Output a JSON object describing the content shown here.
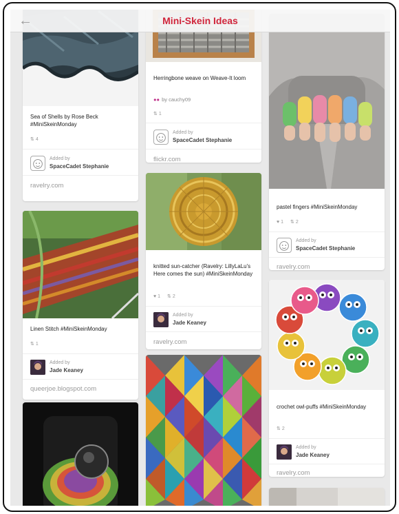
{
  "header": {
    "title": "Mini-Skein Ideas",
    "back_icon": "arrow-left-icon"
  },
  "colors": {
    "title": "#d0253b",
    "background": "#e9e9e9"
  },
  "pins": [
    {
      "description": "Sea of Shells by Rose Beck #MiniSkeinMonday",
      "repins": "4",
      "added_label": "Added by",
      "added_by": "SpaceCadet Stephanie",
      "domain": "ravelry.com"
    },
    {
      "description": "Linen Stitch #MiniSkeinMonday",
      "repins": "1",
      "added_label": "Added by",
      "added_by": "Jade Keaney",
      "domain": "queerjoe.blogspot.com"
    },
    {
      "description": "Herringbone weave on Weave-It loom",
      "by_label": "by cauchy09",
      "repins": "1",
      "added_label": "Added by",
      "added_by": "SpaceCadet Stephanie",
      "domain": "flickr.com"
    },
    {
      "description": "knitted sun-catcher  (Ravelry: LillyLaLu's Here comes the sun) #MiniSkeinMonday",
      "likes": "1",
      "repins": "2",
      "added_label": "Added by",
      "added_by": "Jade Keaney",
      "domain": "ravelry.com"
    },
    {
      "description": "pastel fingers #MiniSkeinMonday",
      "likes": "1",
      "repins": "2",
      "added_label": "Added by",
      "added_by": "SpaceCadet Stephanie",
      "domain": "ravelry.com"
    },
    {
      "description": "crochet owl-puffs #MiniSkeinMonday",
      "repins": "2",
      "added_label": "Added by",
      "added_by": "Jade Keaney",
      "domain": "ravelry.com"
    }
  ]
}
